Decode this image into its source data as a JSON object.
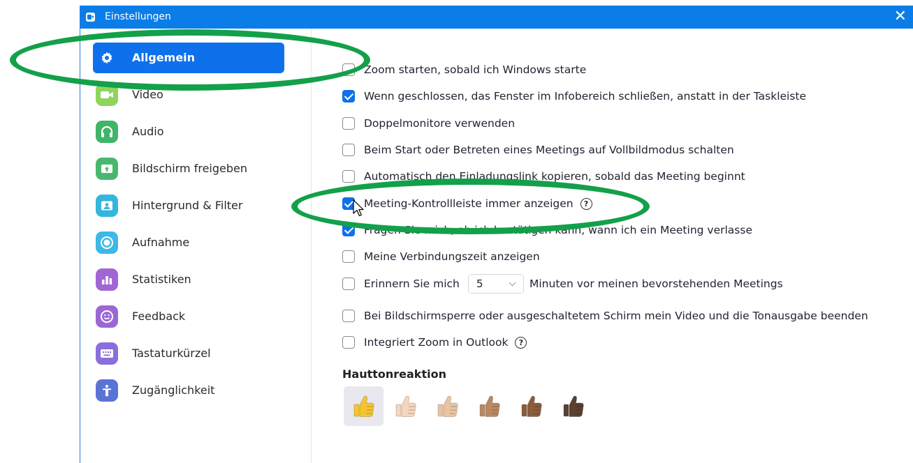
{
  "window": {
    "title": "Einstellungen",
    "close_glyph": "✕"
  },
  "sidebar": {
    "items": [
      {
        "label": "Allgemein",
        "icon": "gear-icon",
        "color": "#0e71eb",
        "active": true
      },
      {
        "label": "Video",
        "icon": "video-camera-icon",
        "color": "#8fd45c"
      },
      {
        "label": "Audio",
        "icon": "headphones-icon",
        "color": "#3fb567"
      },
      {
        "label": "Bildschirm freigeben",
        "icon": "share-screen-icon",
        "color": "#49b86f"
      },
      {
        "label": "Hintergrund & Filter",
        "icon": "background-icon",
        "color": "#35b6dd"
      },
      {
        "label": "Aufnahme",
        "icon": "record-icon",
        "color": "#3eb8e6"
      },
      {
        "label": "Statistiken",
        "icon": "statistics-icon",
        "color": "#a066d6"
      },
      {
        "label": "Feedback",
        "icon": "feedback-smiley-icon",
        "color": "#9b67d6"
      },
      {
        "label": "Tastaturkürzel",
        "icon": "keyboard-icon",
        "color": "#8a6fdc"
      },
      {
        "label": "Zugänglichkeit",
        "icon": "accessibility-icon",
        "color": "#5c73d6"
      }
    ]
  },
  "settings": {
    "options": [
      {
        "label": "Zoom starten, sobald ich Windows starte",
        "checked": false
      },
      {
        "label": "Wenn geschlossen, das Fenster im Infobereich schließen, anstatt in der Taskleiste",
        "checked": true
      },
      {
        "label": "Doppelmonitore verwenden",
        "checked": false
      },
      {
        "label": "Beim Start oder Betreten eines Meetings auf Vollbildmodus schalten",
        "checked": false
      },
      {
        "label": "Automatisch den Einladungslink kopieren, sobald das Meeting beginnt",
        "checked": false
      },
      {
        "label": "Meeting-Kontrollleiste immer anzeigen",
        "checked": true,
        "help": "?"
      },
      {
        "label": "Fragen Sie mich, ob ich bestätigen kann, wann ich ein Meeting verlasse",
        "checked": true
      },
      {
        "label": "Meine Verbindungszeit anzeigen",
        "checked": false
      }
    ],
    "reminder": {
      "label_before": "Erinnern Sie mich",
      "value": "5",
      "label_after": "Minuten vor meinen bevorstehenden Meetings",
      "checked": false
    },
    "lock_option": {
      "label": "Bei Bildschirmsperre oder ausgeschaltetem Schirm mein Video und die Tonausgabe beenden",
      "checked": false
    },
    "outlook_option": {
      "label": "Integriert Zoom in Outlook",
      "checked": false,
      "help": "?"
    },
    "skin_tone": {
      "title": "Hauttonreaktion",
      "tones": [
        "#f5c531",
        "#f5d6bd",
        "#e9c4a3",
        "#b98962",
        "#8a5d3b",
        "#5b4131"
      ],
      "selected": 0
    }
  },
  "annotation_color": "#13a04a"
}
